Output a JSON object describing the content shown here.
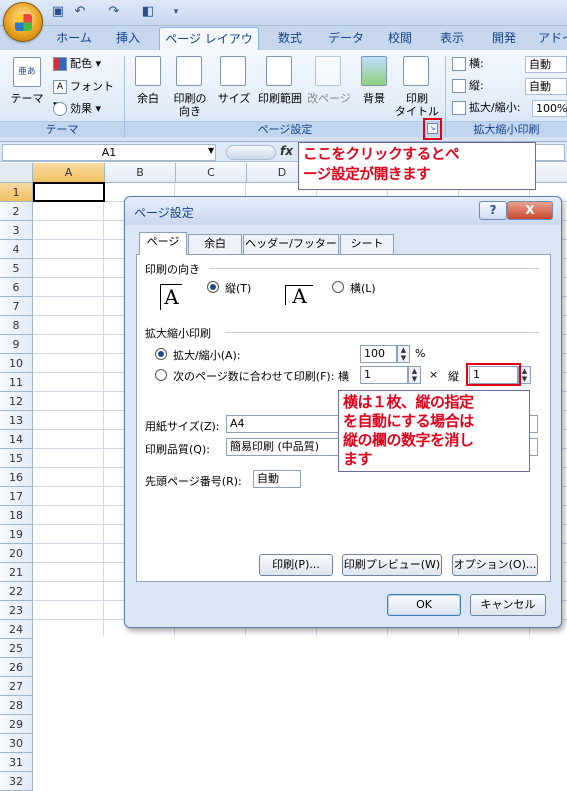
{
  "ribbon": {
    "tabs": [
      "ホーム",
      "挿入",
      "ページ レイアウト",
      "数式",
      "データ",
      "校閲",
      "表示",
      "開発",
      "アドイン"
    ],
    "active_tab": "ページ レイアウト",
    "theme_group": {
      "label": "テーマ",
      "theme_button": "テーマ",
      "colors": "配色",
      "fonts": "フォント",
      "effects": "効果"
    },
    "page_setup_group": {
      "label": "ページ設定",
      "margins": "余白",
      "orientation": "印刷の\n向き",
      "size": "サイズ",
      "print_area": "印刷範囲",
      "breaks": "改ページ",
      "background": "背景",
      "print_titles": "印刷\nタイトル"
    },
    "scale_group": {
      "label": "拡大縮小印刷",
      "width_label": "横:",
      "width_value": "自動",
      "height_label": "縦:",
      "height_value": "自動",
      "scale_label": "拡大/縮小:",
      "scale_value": "100%"
    }
  },
  "formula_bar": {
    "name_box": "A1",
    "fx": "fx"
  },
  "sheet": {
    "columns": [
      "A",
      "B",
      "C",
      "D"
    ],
    "rows": [
      "1",
      "2",
      "3",
      "4",
      "5",
      "6",
      "7",
      "8",
      "9",
      "10",
      "11",
      "12",
      "13",
      "14",
      "15",
      "16",
      "17",
      "18",
      "19",
      "20",
      "21",
      "22",
      "23",
      "24",
      "25",
      "26",
      "27",
      "28",
      "29",
      "30",
      "31",
      "32"
    ],
    "selected_cell": "A1"
  },
  "callouts": {
    "top": "ここをクリックするとペ\nージ設定が開きます",
    "dialog": "横は１枚、縦の指定\nを自動にする場合は\n縦の欄の数字を消し\nます"
  },
  "dialog": {
    "title": "ページ設定",
    "help": "?",
    "close": "X",
    "tabs": [
      "ページ",
      "余白",
      "ヘッダー/フッター",
      "シート"
    ],
    "orientation": {
      "label": "印刷の向き",
      "portrait": "縦(T)",
      "landscape": "横(L)",
      "selected": "portrait"
    },
    "scaling": {
      "label": "拡大縮小印刷",
      "adjust_label": "拡大/縮小(A):",
      "adjust_value": "100",
      "percent": "%",
      "fit_label": "次のページ数に合わせて印刷(F):",
      "wide_label": "横",
      "wide_value": "1",
      "times": "×",
      "tall_label": "縦",
      "tall_value": "1",
      "selected": "adjust"
    },
    "paper_size": {
      "label": "用紙サイズ(Z):",
      "value": "A4"
    },
    "print_quality": {
      "label": "印刷品質(Q):",
      "value": "簡易印刷 (中品質)"
    },
    "first_page": {
      "label": "先頭ページ番号(R):",
      "value": "自動"
    },
    "buttons": {
      "print": "印刷(P)...",
      "preview": "印刷プレビュー(W)",
      "options": "オプション(O)...",
      "ok": "OK",
      "cancel": "キャンセル"
    }
  }
}
